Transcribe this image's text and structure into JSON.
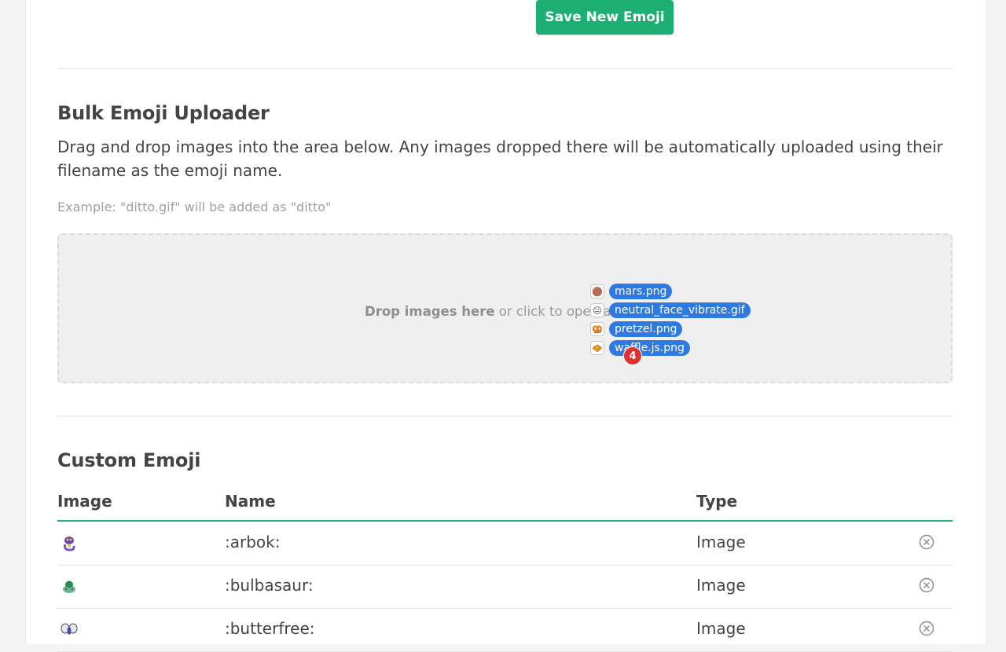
{
  "save_form": {
    "save_label": "Save New Emoji"
  },
  "bulk": {
    "title": "Bulk Emoji Uploader",
    "description": "Drag and drop images into the area below. Any images dropped there will be automatically uploaded using their filename as the emoji name.",
    "example": "Example: \"ditto.gif\" will be added as \"ditto\"",
    "drop_bold": "Drop images here",
    "drop_rest": " or click to open a f",
    "drag_files": [
      "mars.png",
      "neutral_face_vibrate.gif",
      "pretzel.png",
      "waffle.js.png"
    ],
    "drag_icons": [
      "🟤",
      "😐",
      "🥨",
      "🧇"
    ],
    "drag_count": "4"
  },
  "custom": {
    "title": "Custom Emoji",
    "headers": {
      "image": "Image",
      "name": "Name",
      "type": "Type"
    },
    "rows": [
      {
        "name": ":arbok:",
        "type": "Image",
        "icon": "arbok-emoji-icon"
      },
      {
        "name": ":bulbasaur:",
        "type": "Image",
        "icon": "bulbasaur-emoji-icon"
      },
      {
        "name": ":butterfree:",
        "type": "Image",
        "icon": "butterfree-emoji-icon"
      }
    ]
  },
  "colors": {
    "accent": "#1cae72",
    "drag_blue": "#2f7ae0",
    "badge_red": "#e0312f"
  }
}
